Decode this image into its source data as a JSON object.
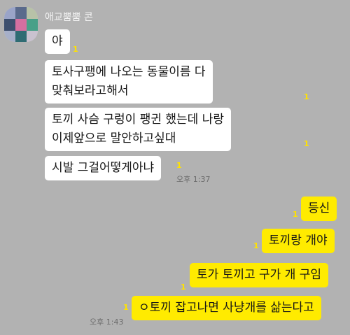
{
  "sender": {
    "name": "애교뿜뿜 콘"
  },
  "incoming": [
    {
      "text": "야",
      "read": "1"
    },
    {
      "lines": [
        "토사구팽에 나오는 동물이름 다",
        "맞춰보라고해서"
      ],
      "read": "1"
    },
    {
      "lines": [
        "토끼 사슴 구렁이 팽귄 했는데 나랑",
        "이제앞으로 말안하고싶대"
      ],
      "read": "1"
    },
    {
      "text": "시발 그걸어떻게아냐",
      "read": "1",
      "time": "오후 1:37"
    }
  ],
  "outgoing": [
    {
      "text": "등신",
      "read": "1"
    },
    {
      "text": "토끼랑 개야",
      "read": "1"
    },
    {
      "text": "토가 토끼고 구가 개 구임",
      "read": "1"
    },
    {
      "text": "ㅇ토끼 잡고나면 사냥개를 삶는다고",
      "read": "1",
      "time": "오후 1:43"
    }
  ],
  "colors": {
    "background": "#b2b2b2",
    "incoming_bubble": "#ffffff",
    "outgoing_bubble": "#ffeb00",
    "unread_count": "#ffe200"
  }
}
